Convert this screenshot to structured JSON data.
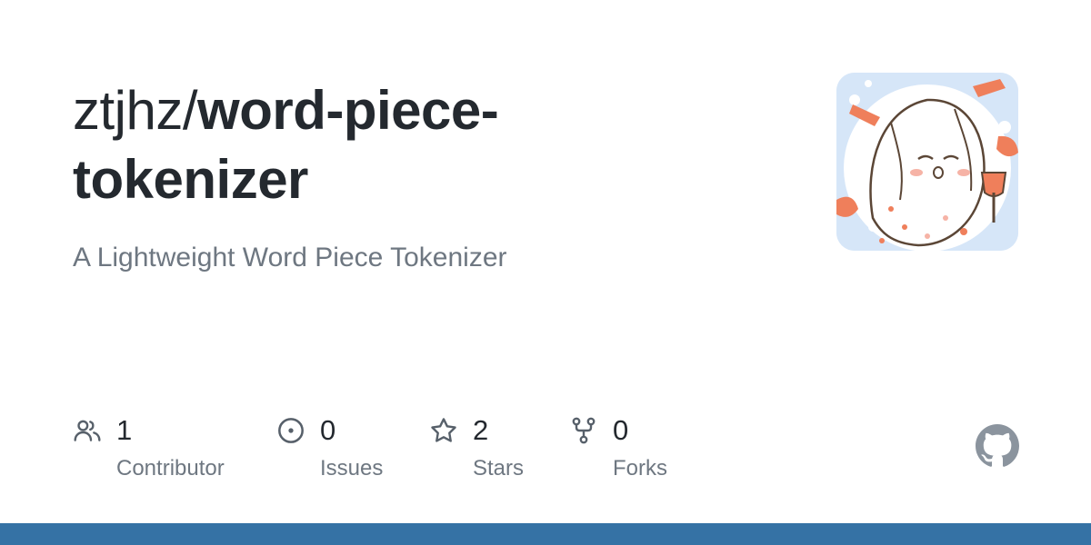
{
  "repo": {
    "owner": "ztjhz/",
    "name": "word-piece-tokenizer",
    "description": "A Lightweight Word Piece Tokenizer"
  },
  "stats": [
    {
      "value": "1",
      "label": "Contributor",
      "icon": "people-icon"
    },
    {
      "value": "0",
      "label": "Issues",
      "icon": "issue-opened-icon"
    },
    {
      "value": "2",
      "label": "Stars",
      "icon": "star-icon"
    },
    {
      "value": "0",
      "label": "Forks",
      "icon": "repo-forked-icon"
    }
  ],
  "logo": "github-mark-icon",
  "colors": {
    "title": "#24292f",
    "muted": "#6e7781",
    "icon": "#57606a",
    "logo": "#8b949e",
    "bottom_bar": "#3572a5",
    "avatar_bg": "#d6e6f8"
  }
}
